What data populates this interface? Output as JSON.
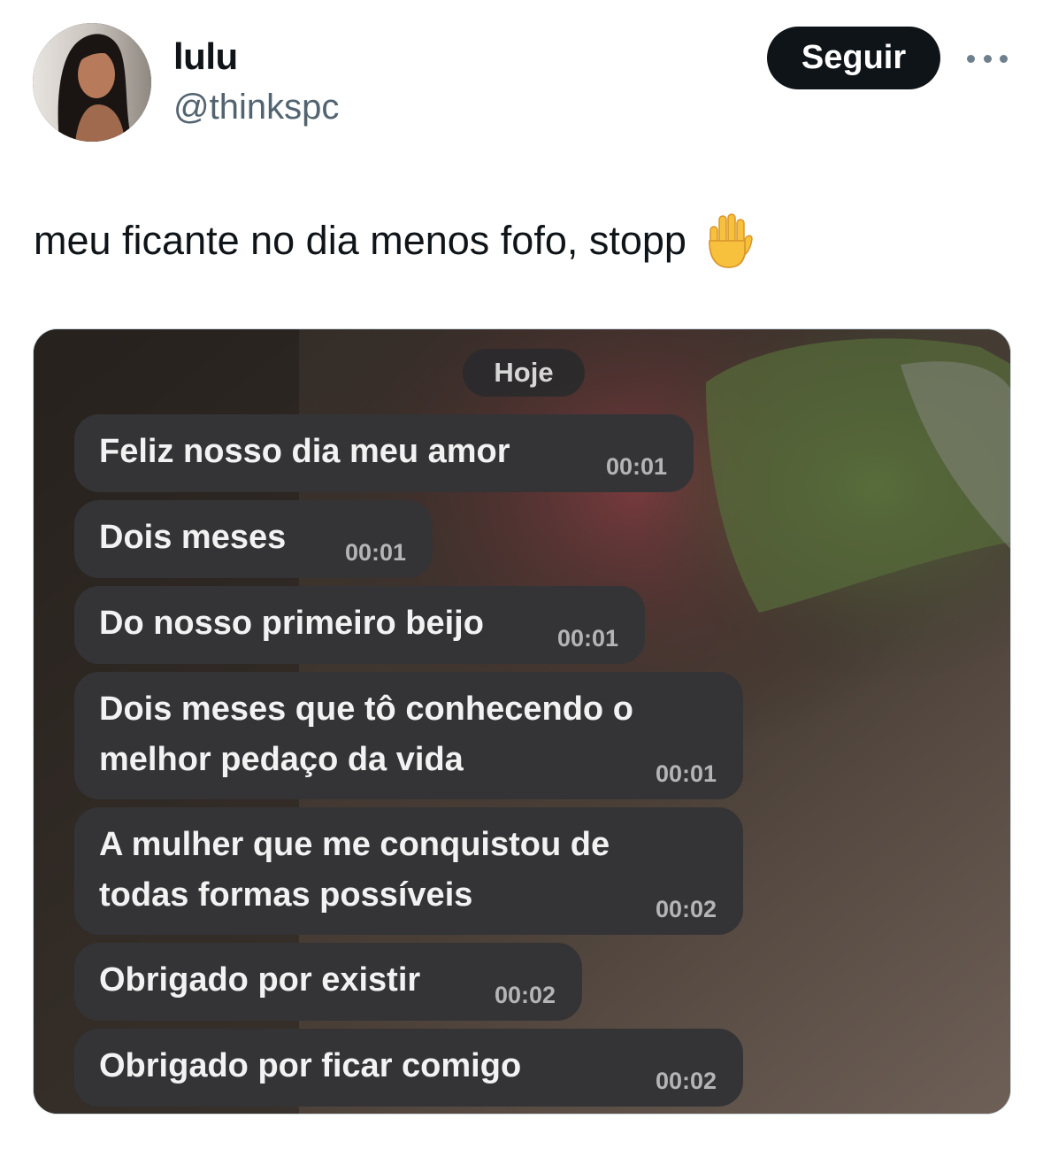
{
  "author": {
    "display_name": "lulu",
    "handle": "@thinkspc",
    "follow_label": "Seguir"
  },
  "tweet": {
    "text": "meu ficante no dia menos fofo, stopp",
    "emoji_icon": "raised-hand-icon"
  },
  "chat": {
    "day_label": "Hoje",
    "messages": [
      {
        "text": "Feliz nosso dia meu amor",
        "time": "00:01"
      },
      {
        "text": "Dois meses",
        "time": "00:01"
      },
      {
        "text": "Do nosso primeiro beijo",
        "time": "00:01"
      },
      {
        "text": "Dois meses que tô conhecendo o\nmelhor pedaço da vida",
        "time": "00:01"
      },
      {
        "text": "A mulher que me conquistou de\ntodas formas possíveis",
        "time": "00:02"
      },
      {
        "text": "Obrigado por existir",
        "time": "00:02"
      },
      {
        "text": "Obrigado por ficar comigo",
        "time": "00:02"
      }
    ]
  },
  "colors": {
    "follow_button_bg": "#0f1419",
    "handle_text": "#536471",
    "bubble_bg": "#343436",
    "timestamp_text": "#b4b4b6"
  }
}
